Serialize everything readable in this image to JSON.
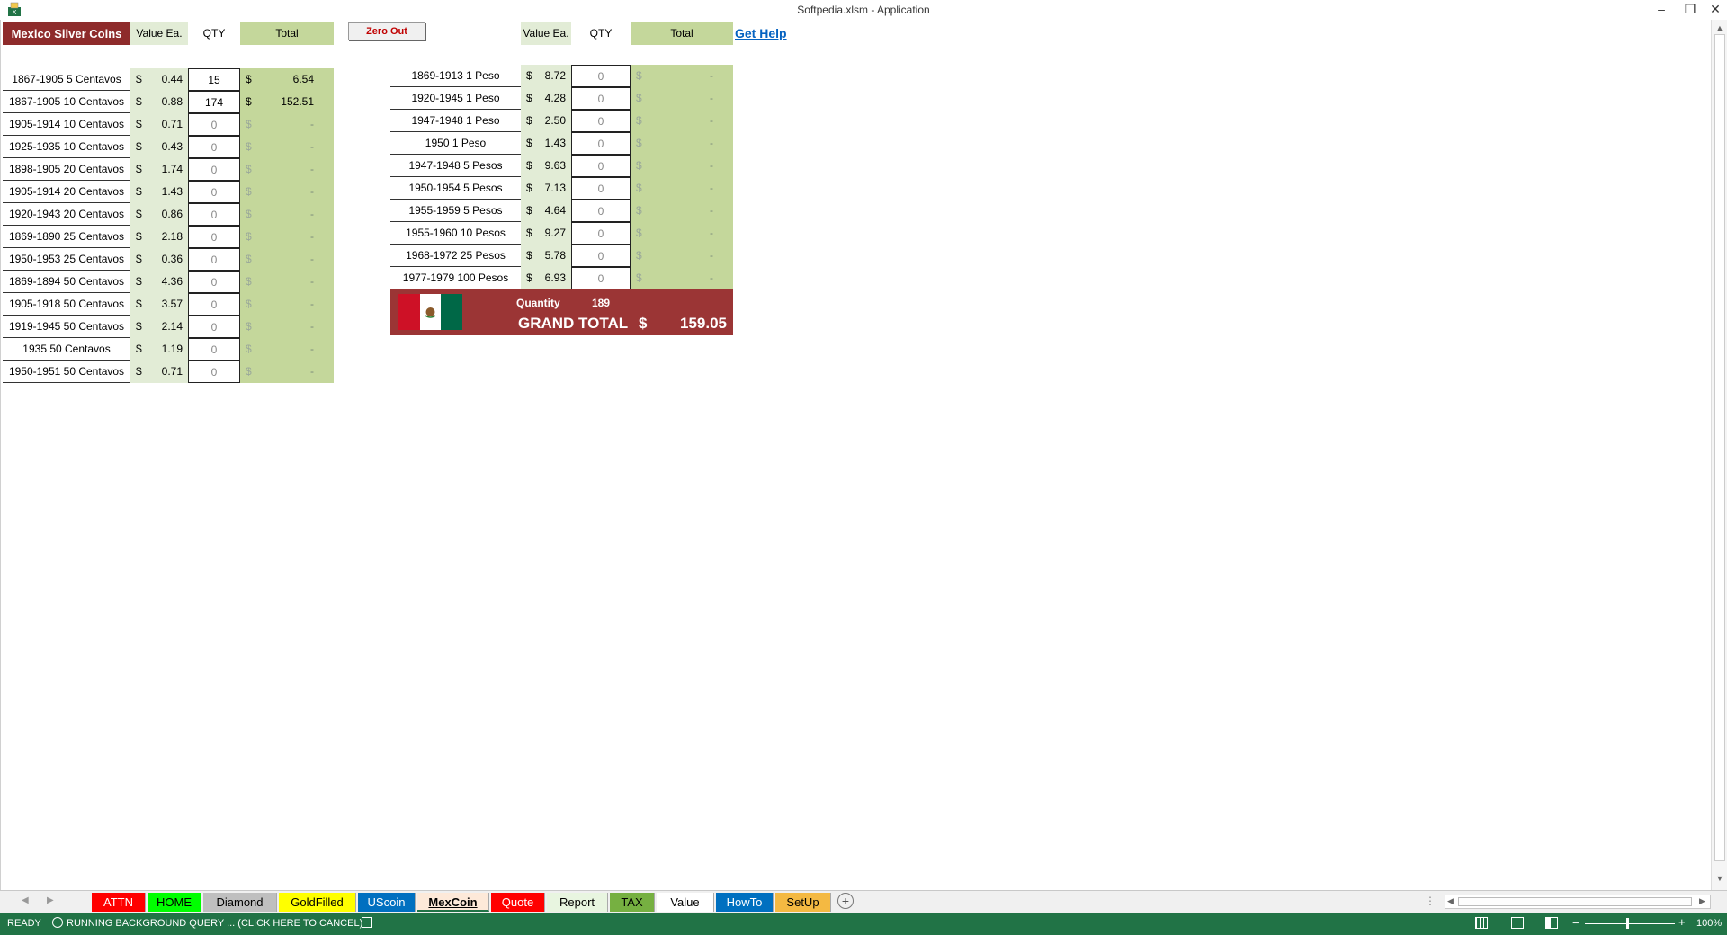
{
  "window": {
    "title": "Softpedia.xlsm - Application",
    "minimize": "–",
    "restore": "❐",
    "close": "✕"
  },
  "header": {
    "title": "Mexico Silver Coins",
    "value_ea": "Value Ea.",
    "qty": "QTY",
    "total": "Total",
    "zero_out": "Zero Out",
    "value_ea_2": "Value Ea.",
    "qty_2": "QTY",
    "total_2": "Total",
    "get_help": "Get Help"
  },
  "currency": "$",
  "left_coins": [
    {
      "name": "1867-1905 5 Centavos",
      "value": "0.44",
      "qty": "15",
      "total": "6.54",
      "filled": true
    },
    {
      "name": "1867-1905 10 Centavos",
      "value": "0.88",
      "qty": "174",
      "total": "152.51",
      "filled": true
    },
    {
      "name": "1905-1914 10 Centavos",
      "value": "0.71",
      "qty": "0",
      "total": "-",
      "filled": false
    },
    {
      "name": "1925-1935 10 Centavos",
      "value": "0.43",
      "qty": "0",
      "total": "-",
      "filled": false
    },
    {
      "name": "1898-1905 20 Centavos",
      "value": "1.74",
      "qty": "0",
      "total": "-",
      "filled": false
    },
    {
      "name": "1905-1914 20 Centavos",
      "value": "1.43",
      "qty": "0",
      "total": "-",
      "filled": false
    },
    {
      "name": "1920-1943 20 Centavos",
      "value": "0.86",
      "qty": "0",
      "total": "-",
      "filled": false
    },
    {
      "name": "1869-1890 25 Centavos",
      "value": "2.18",
      "qty": "0",
      "total": "-",
      "filled": false
    },
    {
      "name": "1950-1953 25 Centavos",
      "value": "0.36",
      "qty": "0",
      "total": "-",
      "filled": false
    },
    {
      "name": "1869-1894 50 Centavos",
      "value": "4.36",
      "qty": "0",
      "total": "-",
      "filled": false
    },
    {
      "name": "1905-1918 50 Centavos",
      "value": "3.57",
      "qty": "0",
      "total": "-",
      "filled": false
    },
    {
      "name": "1919-1945 50 Centavos",
      "value": "2.14",
      "qty": "0",
      "total": "-",
      "filled": false
    },
    {
      "name": "1935 50 Centavos",
      "value": "1.19",
      "qty": "0",
      "total": "-",
      "filled": false
    },
    {
      "name": "1950-1951 50 Centavos",
      "value": "0.71",
      "qty": "0",
      "total": "-",
      "filled": false
    }
  ],
  "right_coins": [
    {
      "name": "1869-1913 1 Peso",
      "value": "8.72",
      "qty": "0",
      "total": "-"
    },
    {
      "name": "1920-1945 1 Peso",
      "value": "4.28",
      "qty": "0",
      "total": "-"
    },
    {
      "name": "1947-1948 1 Peso",
      "value": "2.50",
      "qty": "0",
      "total": "-"
    },
    {
      "name": "1950 1 Peso",
      "value": "1.43",
      "qty": "0",
      "total": "-"
    },
    {
      "name": "1947-1948 5 Pesos",
      "value": "9.63",
      "qty": "0",
      "total": "-"
    },
    {
      "name": "1950-1954 5 Pesos",
      "value": "7.13",
      "qty": "0",
      "total": "-"
    },
    {
      "name": "1955-1959 5 Pesos",
      "value": "4.64",
      "qty": "0",
      "total": "-"
    },
    {
      "name": "1955-1960 10 Pesos",
      "value": "9.27",
      "qty": "0",
      "total": "-"
    },
    {
      "name": "1968-1972 25 Pesos",
      "value": "5.78",
      "qty": "0",
      "total": "-"
    },
    {
      "name": "1977-1979 100 Pesos",
      "value": "6.93",
      "qty": "0",
      "total": "-"
    }
  ],
  "summary": {
    "quantity_label": "Quantity",
    "quantity_value": "189",
    "grand_total_label": "GRAND TOTAL",
    "grand_total_currency": "$",
    "grand_total_value": "159.05"
  },
  "tabs": [
    {
      "label": "ATTN",
      "bg": "#ff0000",
      "color": "#ffffff"
    },
    {
      "label": "HOME",
      "bg": "#00ff00",
      "color": "#000000"
    },
    {
      "label": "Diamond",
      "bg": "#bfbfbf",
      "color": "#000000"
    },
    {
      "label": "GoldFilled",
      "bg": "#ffff00",
      "color": "#000000"
    },
    {
      "label": "UScoin",
      "bg": "#0070c0",
      "color": "#ffffff"
    },
    {
      "label": "MexCoin",
      "bg": "#fde9d9",
      "color": "#000000",
      "active": true
    },
    {
      "label": "Quote",
      "bg": "#ff0000",
      "color": "#ffffff"
    },
    {
      "label": "Report",
      "bg": "#e8f5e0",
      "color": "#000000"
    },
    {
      "label": "TAX",
      "bg": "#76b041",
      "color": "#000000"
    },
    {
      "label": "Value",
      "bg": "#ffffff",
      "color": "#000000"
    },
    {
      "label": "HowTo",
      "bg": "#0070c0",
      "color": "#ffffff"
    },
    {
      "label": "SetUp",
      "bg": "#f4b942",
      "color": "#000000"
    }
  ],
  "status": {
    "ready": "READY",
    "query": "RUNNING BACKGROUND QUERY ...   (CLICK HERE TO CANCEL)",
    "zoom": "100%"
  }
}
